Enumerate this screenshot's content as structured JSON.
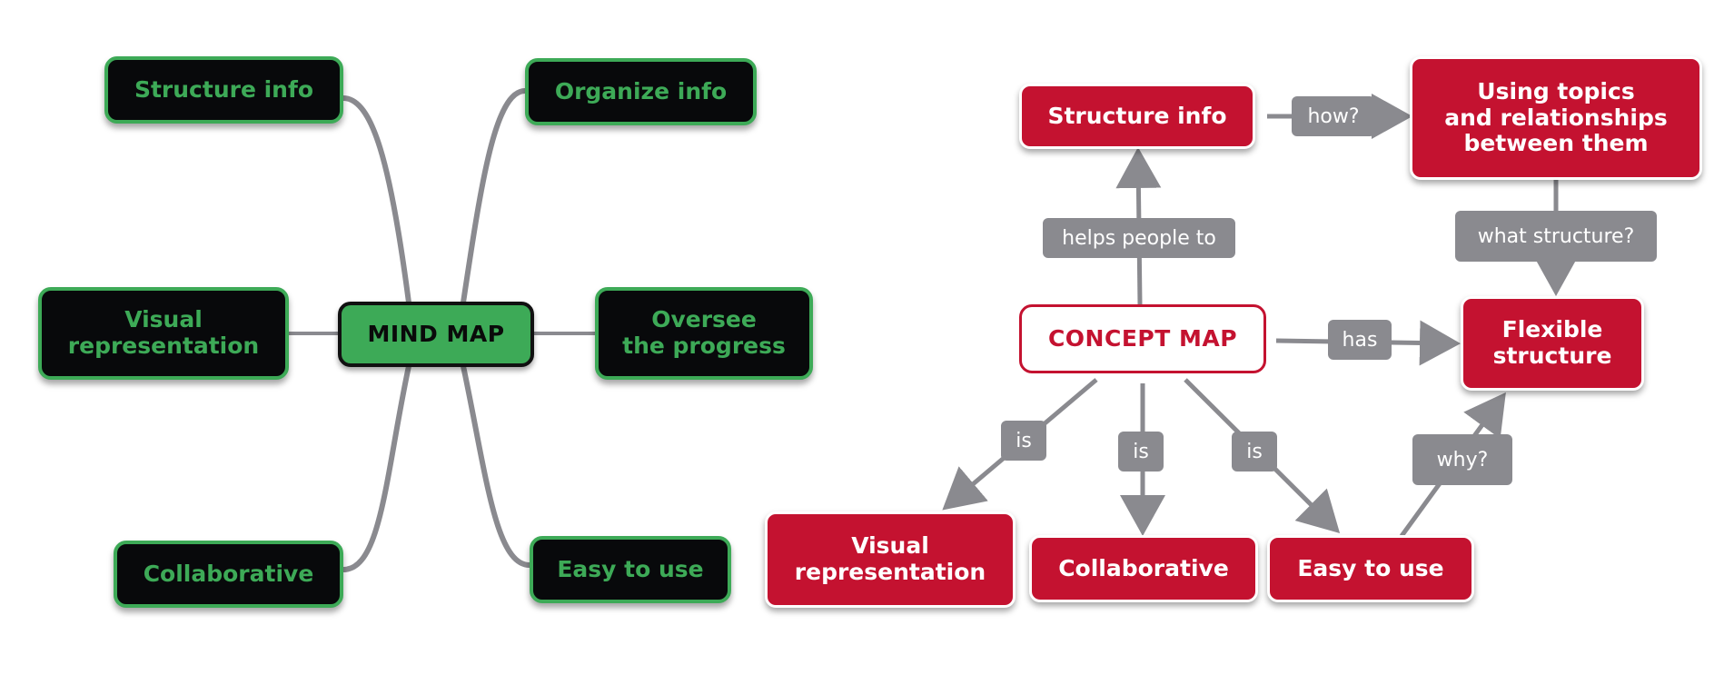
{
  "mind_map": {
    "central": "MIND MAP",
    "topics": [
      {
        "id": "structure-info",
        "label": "Structure info"
      },
      {
        "id": "organize-info",
        "label": "Organize info"
      },
      {
        "id": "visual-representation",
        "label": "Visual\nrepresentation"
      },
      {
        "id": "oversee-progress",
        "label": "Oversee\nthe progress"
      },
      {
        "id": "collaborative",
        "label": "Collaborative"
      },
      {
        "id": "easy-to-use",
        "label": "Easy to use"
      }
    ]
  },
  "concept_map": {
    "central": "CONCEPT MAP",
    "nodes": [
      {
        "id": "structure-info",
        "label": "Structure info"
      },
      {
        "id": "using-topics",
        "label": "Using topics\nand relationships\nbetween them"
      },
      {
        "id": "flexible-structure",
        "label": "Flexible\nstructure"
      },
      {
        "id": "visual-representation",
        "label": "Visual\nrepresentation"
      },
      {
        "id": "collaborative",
        "label": "Collaborative"
      },
      {
        "id": "easy-to-use",
        "label": "Easy to use"
      }
    ],
    "links": [
      {
        "from": "concept-map",
        "to": "structure-info",
        "label": "helps people to"
      },
      {
        "from": "structure-info",
        "to": "using-topics",
        "label": "how?"
      },
      {
        "from": "using-topics",
        "to": "flexible-structure",
        "label": "what structure?"
      },
      {
        "from": "concept-map",
        "to": "flexible-structure",
        "label": "has"
      },
      {
        "from": "concept-map",
        "to": "visual-representation",
        "label": "is"
      },
      {
        "from": "concept-map",
        "to": "collaborative",
        "label": "is"
      },
      {
        "from": "concept-map",
        "to": "easy-to-use",
        "label": "is"
      },
      {
        "from": "easy-to-use",
        "to": "flexible-structure",
        "label": "why?"
      }
    ]
  },
  "colors": {
    "mind_green": "#3daa57",
    "mind_dark": "#08090b",
    "concept_red": "#c41230",
    "link_gray": "#8a8a8f"
  }
}
